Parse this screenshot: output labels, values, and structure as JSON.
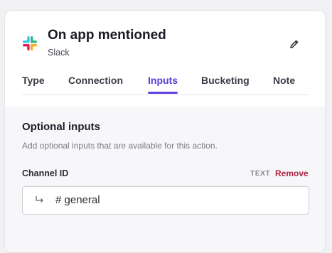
{
  "header": {
    "title": "On app mentioned",
    "app_name": "Slack",
    "logo_icon": "slack-logo-icon",
    "edit_icon": "pencil-icon"
  },
  "tabs": [
    {
      "label": "Type",
      "active": false
    },
    {
      "label": "Connection",
      "active": false
    },
    {
      "label": "Inputs",
      "active": true
    },
    {
      "label": "Bucketing",
      "active": false
    },
    {
      "label": "Note",
      "active": false
    }
  ],
  "optional_inputs": {
    "title": "Optional inputs",
    "description": "Add optional inputs that are available for this action.",
    "field": {
      "label": "Channel ID",
      "type": "TEXT",
      "remove_label": "Remove",
      "value": "# general",
      "value_icon": "return-arrow-icon"
    }
  },
  "colors": {
    "accent": "#6340e0",
    "remove": "#b0243f"
  }
}
